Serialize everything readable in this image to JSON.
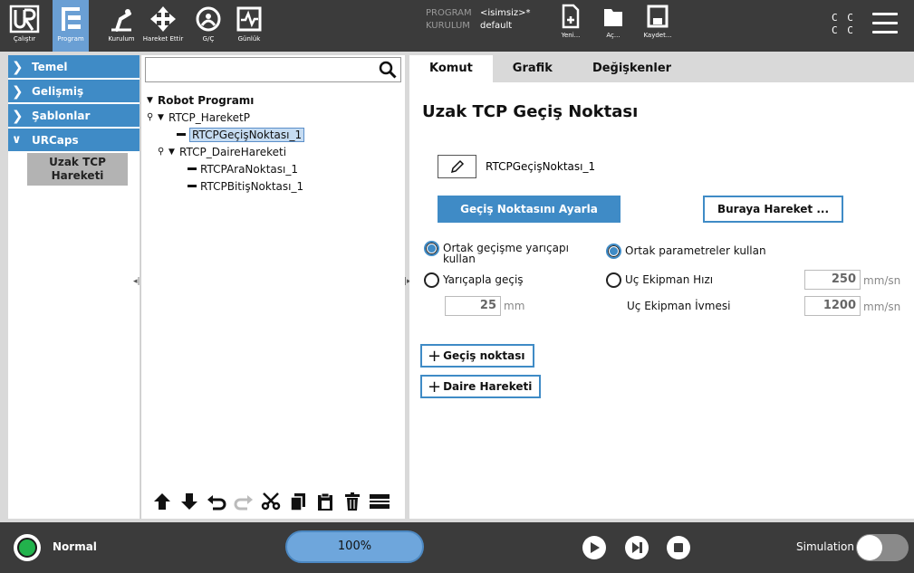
{
  "header": {
    "nav": [
      {
        "label": "Çalıştır",
        "icon": "ur-logo-icon"
      },
      {
        "label": "Program",
        "icon": "program-icon"
      },
      {
        "label": "Kurulum",
        "icon": "installation-icon"
      },
      {
        "label": "Hareket Ettir",
        "icon": "move-icon"
      },
      {
        "label": "G/Ç",
        "icon": "io-icon"
      },
      {
        "label": "Günlük",
        "icon": "log-icon"
      }
    ],
    "program_key": "PROGRAM",
    "program_value": "<isimsiz>*",
    "installation_key": "KURULUM",
    "installation_value": "default",
    "file_buttons": [
      {
        "label": "Yeni...",
        "icon": "new-file-icon"
      },
      {
        "label": "Aç...",
        "icon": "folder-icon"
      },
      {
        "label": "Kaydet...",
        "icon": "save-icon"
      }
    ],
    "cc_top": "C C",
    "cc_bottom": "C C"
  },
  "sidebar": {
    "items": [
      {
        "label": "Temel",
        "expanded": false
      },
      {
        "label": "Gelişmiş",
        "expanded": false
      },
      {
        "label": "Şablonlar",
        "expanded": false
      },
      {
        "label": "URCaps",
        "expanded": true
      }
    ],
    "subitem": "Uzak TCP Hareketi"
  },
  "tree": {
    "search_placeholder": "",
    "rows": [
      {
        "label": "Robot Programı",
        "bold": true
      },
      {
        "label": "RTCP_HareketP"
      },
      {
        "label": "RTCPGeçişNoktası_1",
        "selected": true
      },
      {
        "label": "RTCP_DaireHareketi"
      },
      {
        "label": "RTCPAraNoktası_1"
      },
      {
        "label": "RTCPBitişNoktası_1"
      }
    ]
  },
  "main": {
    "tabs": [
      "Komut",
      "Grafik",
      "Değişkenler"
    ],
    "active_tab": "Komut",
    "title": "Uzak TCP Geçiş Noktası",
    "waypoint_name": "RTCPGeçişNoktası_1",
    "set_waypoint_label": "Geçiş Noktasını Ayarla",
    "move_here_label": "Buraya Hareket ...",
    "radio_shared_blend": "Ortak geçişme yarıçapı kullan",
    "radio_blend_radius": "Yarıçapla geçiş",
    "blend_value": "25",
    "blend_unit": "mm",
    "radio_shared_params": "Ortak parametreler kullan",
    "radio_tool_speed": "Uç Ekipman Hızı",
    "tool_speed_value": "250",
    "tool_speed_unit": "mm/sn",
    "tool_accel_label": "Uç Ekipman İvmesi",
    "tool_accel_value": "1200",
    "tool_accel_unit": "mm/sn",
    "add_waypoint_label": "Geçiş noktası",
    "add_circle_label": "Daire Hareketi"
  },
  "footer": {
    "status": "Normal",
    "speed": "100%",
    "simulation_label": "Simulation",
    "simulation_on": false,
    "status_color": "#22b24c",
    "accent": "#3f8bc6"
  }
}
